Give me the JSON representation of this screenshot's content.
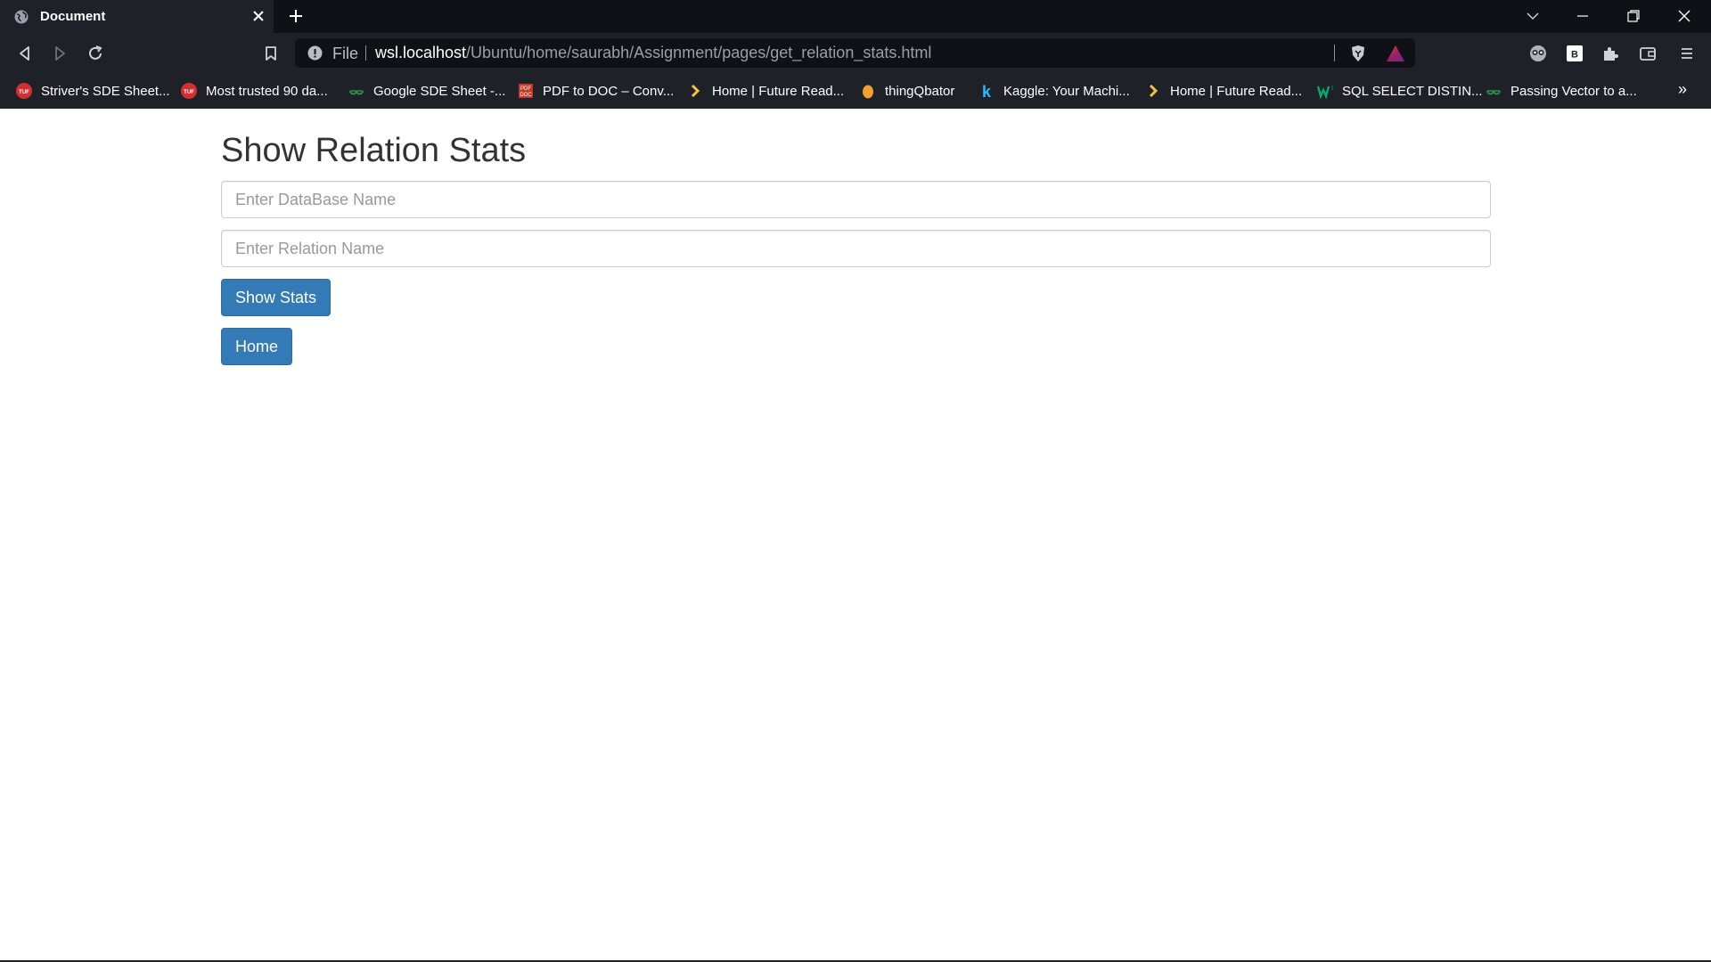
{
  "browser": {
    "tab_title": "Document",
    "url_scheme_label": "File",
    "url_host": "wsl.localhost",
    "url_path": "/Ubuntu/home/saurabh/Assignment/pages/get_relation_stats.html",
    "bookmarks": [
      {
        "label": "Striver's SDE Sheet...",
        "icon": "tuf-icon",
        "color": "#d32f2f"
      },
      {
        "label": "Most trusted 90 da...",
        "icon": "tuf-icon",
        "color": "#d32f2f"
      },
      {
        "label": "Google SDE Sheet -...",
        "icon": "gfg-icon",
        "color": "#2f8d46"
      },
      {
        "label": "PDF to DOC – Conv...",
        "icon": "pdf-doc-icon",
        "color": "#c0392b"
      },
      {
        "label": "Home | Future Read...",
        "icon": "future-ready-icon",
        "color": "#f5c242"
      },
      {
        "label": "thingQbator",
        "icon": "thingqbator-icon",
        "color": "#f0a030"
      },
      {
        "label": "Kaggle: Your Machi...",
        "icon": "kaggle-icon",
        "color": "#20beff"
      },
      {
        "label": "Home | Future Read...",
        "icon": "future-ready-icon",
        "color": "#f5c242"
      },
      {
        "label": "SQL SELECT DISTIN...",
        "icon": "w3schools-icon",
        "color": "#04aa6d"
      },
      {
        "label": "Passing Vector to a...",
        "icon": "gfg-icon",
        "color": "#2f8d46"
      }
    ],
    "more_bookmarks": "»"
  },
  "page": {
    "title": "Show Relation Stats",
    "database_placeholder": "Enter DataBase Name",
    "relation_placeholder": "Enter Relation Name",
    "show_stats_label": "Show Stats",
    "home_label": "Home"
  },
  "colors": {
    "primary_button": "#337ab7",
    "chrome_dark": "#1f2129"
  }
}
